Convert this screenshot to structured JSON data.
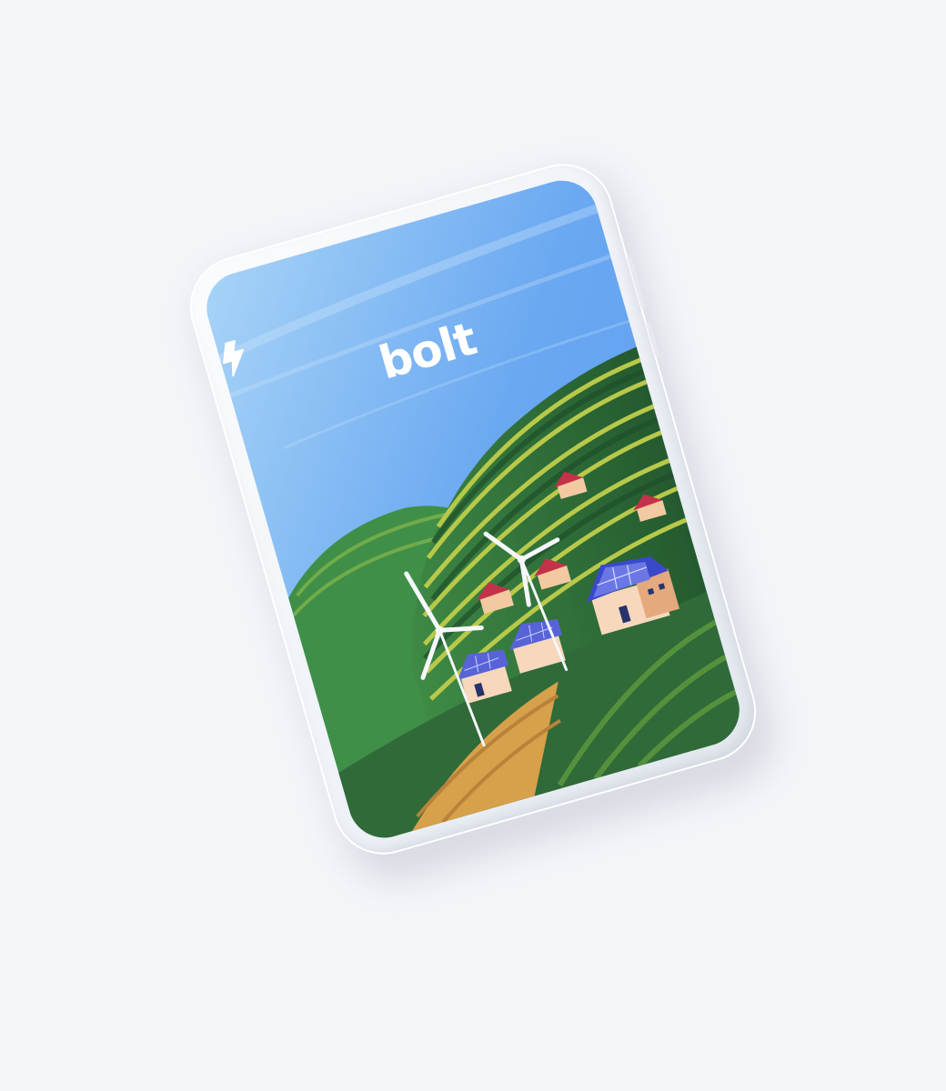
{
  "app": {
    "brand_name": "bolt",
    "logo_icon": "lightning-bolt-icon"
  },
  "colors": {
    "background": "#f3f5f9",
    "sky_top": "#5f9ff2",
    "sky_bottom": "#a8d4f7",
    "hill_dark": "#2e6b3a",
    "hill_stripe": "#b8c94a",
    "field": "#d7a04a",
    "roof_red": "#c4324a",
    "solar_blue": "#5863d8",
    "house_wall": "#f3c9a1"
  }
}
